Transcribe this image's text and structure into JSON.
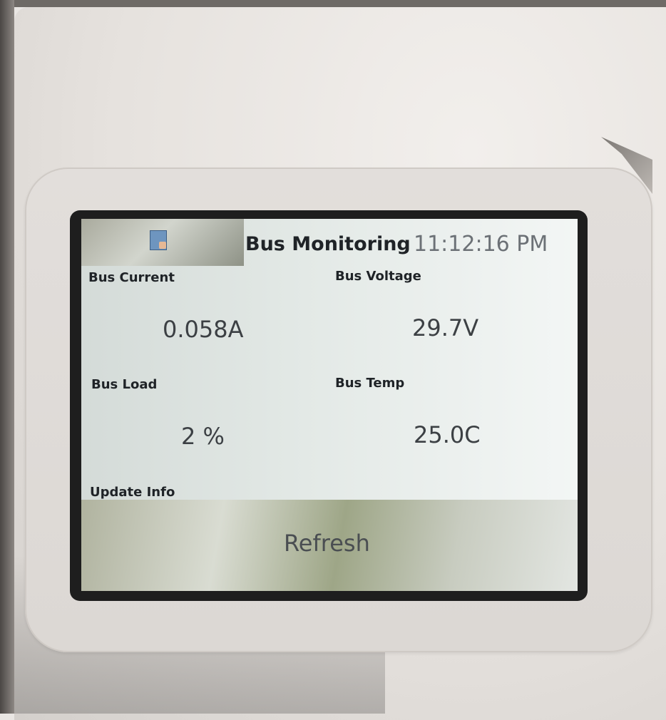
{
  "header": {
    "app_icon": "app-icon",
    "title": "Bus Monitoring",
    "clock": "11:12:16 PM"
  },
  "readings": {
    "bus_current": {
      "label": "Bus Current",
      "value": "0.058A"
    },
    "bus_voltage": {
      "label": "Bus Voltage",
      "value": "29.7V"
    },
    "bus_load": {
      "label": "Bus Load",
      "value": "2 %"
    },
    "bus_temp": {
      "label": "Bus Temp",
      "value": "25.0C"
    }
  },
  "update": {
    "label": "Update Info",
    "refresh_label": "Refresh"
  }
}
